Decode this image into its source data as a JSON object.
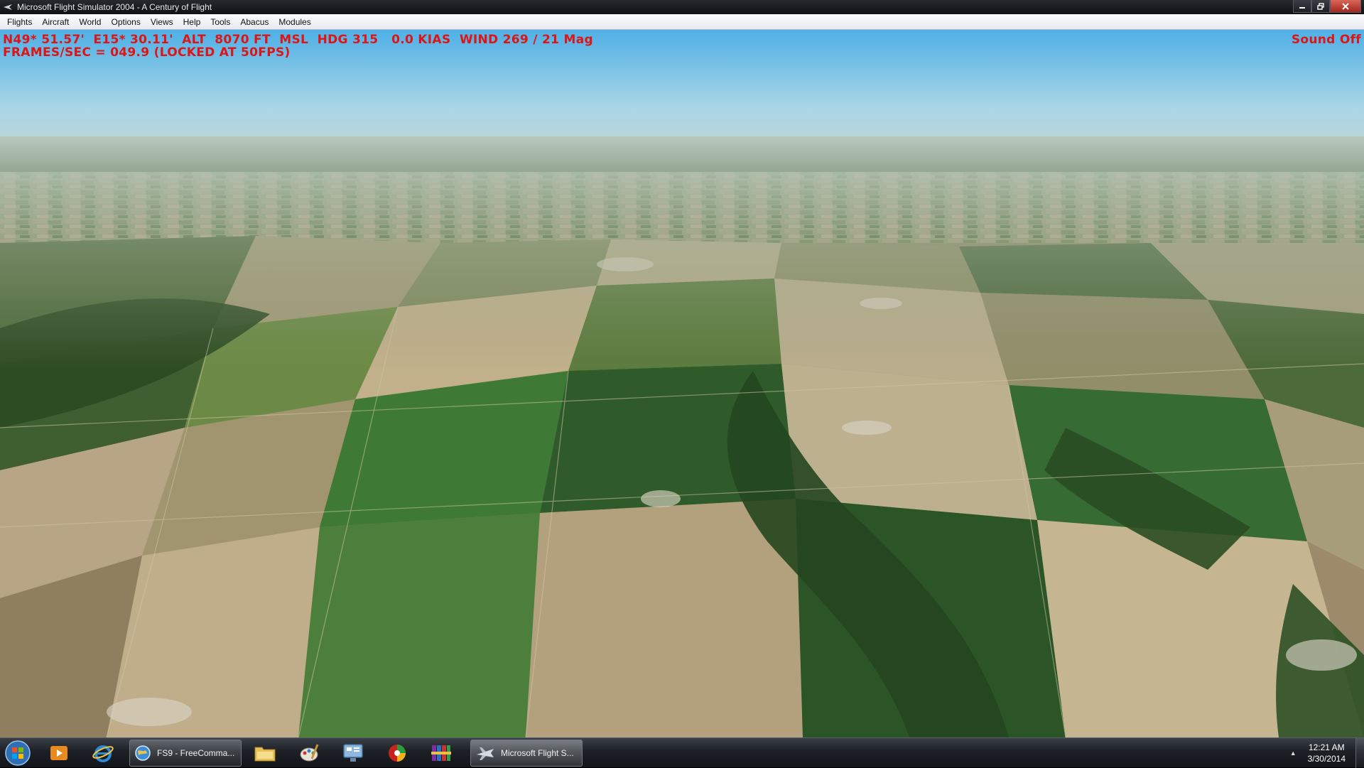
{
  "window": {
    "title": "Microsoft Flight Simulator 2004 - A Century of Flight"
  },
  "menubar": {
    "items": [
      "Flights",
      "Aircraft",
      "World",
      "Options",
      "Views",
      "Help",
      "Tools",
      "Abacus",
      "Modules"
    ]
  },
  "hud": {
    "line1": "N49* 51.57'  E15* 30.11'  ALT  8070 FT  MSL  HDG 315   0.0 KIAS  WIND 269 / 21 Mag",
    "line2": "FRAMES/SEC = 049.9 (LOCKED AT 50FPS)",
    "sound": "Sound Off",
    "color": "#e01414"
  },
  "taskbar": {
    "tasks": [
      {
        "label": "FS9 - FreeComma...",
        "icon": "globe-icon"
      },
      {
        "label": "Microsoft Flight S...",
        "icon": "airplane-icon"
      }
    ],
    "pinned_icons": [
      "media-player-icon",
      "internet-explorer-icon",
      "folder-icon",
      "paint-icon",
      "control-panel-icon",
      "color-app-icon",
      "archive-books-icon"
    ],
    "clock": {
      "time": "12:21 AM",
      "date": "3/30/2014"
    }
  }
}
